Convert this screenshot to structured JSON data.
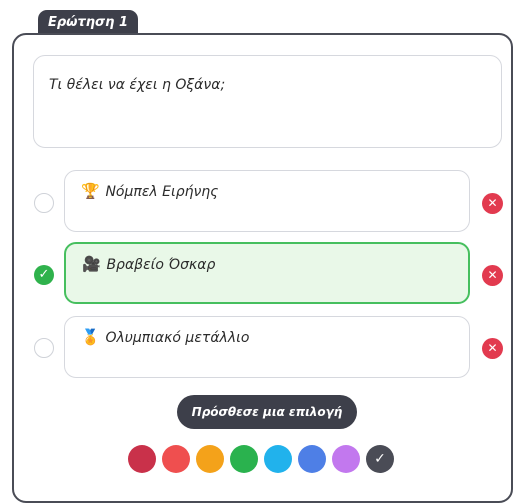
{
  "question": {
    "tab_label": "Ερώτηση 1",
    "text": "Τι θέλει να έχει η Οξάνα;"
  },
  "answers": [
    {
      "icon": "trophy-icon",
      "glyph": "🏆",
      "label": "Νόμπελ Ειρήνης",
      "selected": false
    },
    {
      "icon": "film-camera-icon",
      "glyph": "🎥",
      "label": "Βραβείο Όσκαρ",
      "selected": true
    },
    {
      "icon": "medal-icon",
      "glyph": "🏅",
      "label": "Ολυμπιακό μετάλλιο",
      "selected": false
    }
  ],
  "add_button_label": "Πρόσθεσε μια επιλογή",
  "delete_icon": "close-icon",
  "check_icon": "checkmark-icon",
  "colors": [
    "#c9314a",
    "#ef4f4f",
    "#f4a21a",
    "#2ab24e",
    "#21b2ec",
    "#4e7fe6",
    "#c278ee",
    "#4a4c56"
  ],
  "selected_color": "#4a4c56"
}
